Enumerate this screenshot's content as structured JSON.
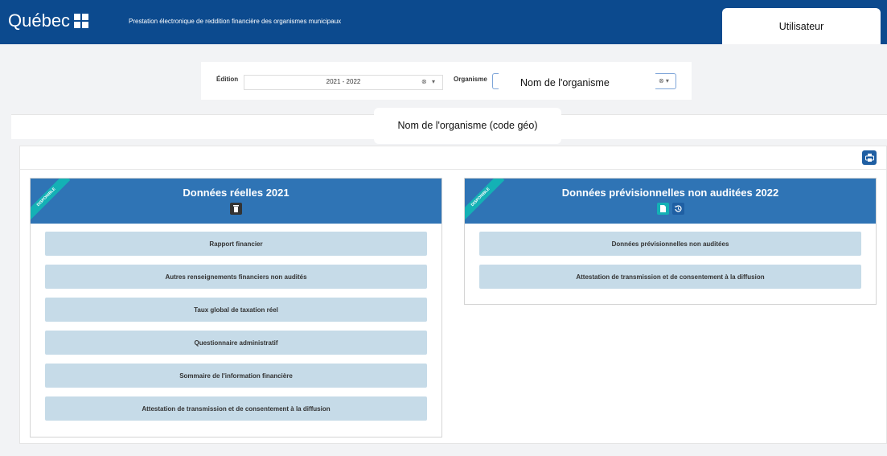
{
  "header": {
    "logo_text": "Québec",
    "subtitle": "Prestation électronique de reddition financière des organismes municipaux",
    "user_label": "Utilisateur"
  },
  "selector": {
    "edition_label": "Édition",
    "edition_value": "2021 - 2022",
    "organisme_label": "Organisme",
    "organisme_value": "Nom de l'organisme"
  },
  "banner": {
    "org_code": "Nom de l'organisme (code géo)"
  },
  "cards": [
    {
      "ribbon": "DISPONIBLE",
      "title": "Données réelles 2021",
      "items": [
        "Rapport financier",
        "Autres renseignements financiers non audités",
        "Taux global de taxation réel",
        "Questionnaire administratif",
        "Sommaire de l'information financière",
        "Attestation de transmission et de consentement à la diffusion"
      ]
    },
    {
      "ribbon": "DISPONIBLE",
      "title": "Données prévisionnelles non auditées 2022",
      "items": [
        "Données prévisionnelles non auditées",
        "Attestation de transmission et de consentement à la diffusion"
      ]
    }
  ],
  "colors": {
    "header": "#0c4a8e",
    "card_header": "#2f74b5",
    "item_bg": "#c6dbe8",
    "ribbon": "#14b1b5"
  },
  "icons": {
    "print": "print-icon",
    "delete": "trash-icon",
    "document": "document-icon",
    "history": "history-icon",
    "clear": "clear-icon",
    "dropdown": "caret-down-icon"
  }
}
